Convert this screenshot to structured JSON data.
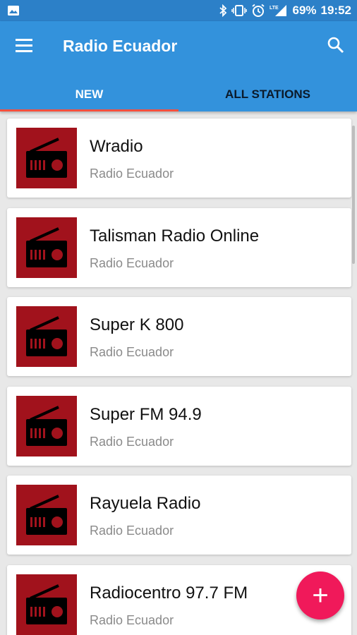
{
  "status_bar": {
    "battery": "69%",
    "time": "19:52",
    "icons": [
      "image-icon",
      "bluetooth-icon",
      "vibrate-icon",
      "alarm-icon",
      "lte-signal-icon",
      "battery-icon"
    ]
  },
  "app_bar": {
    "title": "Radio Ecuador",
    "menu_icon": "menu-icon",
    "search_icon": "search-icon",
    "color": "#3392dc"
  },
  "tabs": [
    {
      "label": "NEW",
      "active": true
    },
    {
      "label": "ALL STATIONS",
      "active": false
    }
  ],
  "stations": [
    {
      "name": "Wradio",
      "subtitle": "Radio Ecuador"
    },
    {
      "name": "Talisman Radio Online",
      "subtitle": "Radio Ecuador"
    },
    {
      "name": "Super K 800",
      "subtitle": "Radio Ecuador"
    },
    {
      "name": "Super FM 94.9",
      "subtitle": "Radio Ecuador"
    },
    {
      "name": "Rayuela Radio",
      "subtitle": "Radio Ecuador"
    },
    {
      "name": "Radiocentro 97.7 FM",
      "subtitle": "Radio Ecuador"
    }
  ],
  "fab": {
    "label": "+",
    "icon": "add-icon",
    "color": "#f0195a"
  }
}
